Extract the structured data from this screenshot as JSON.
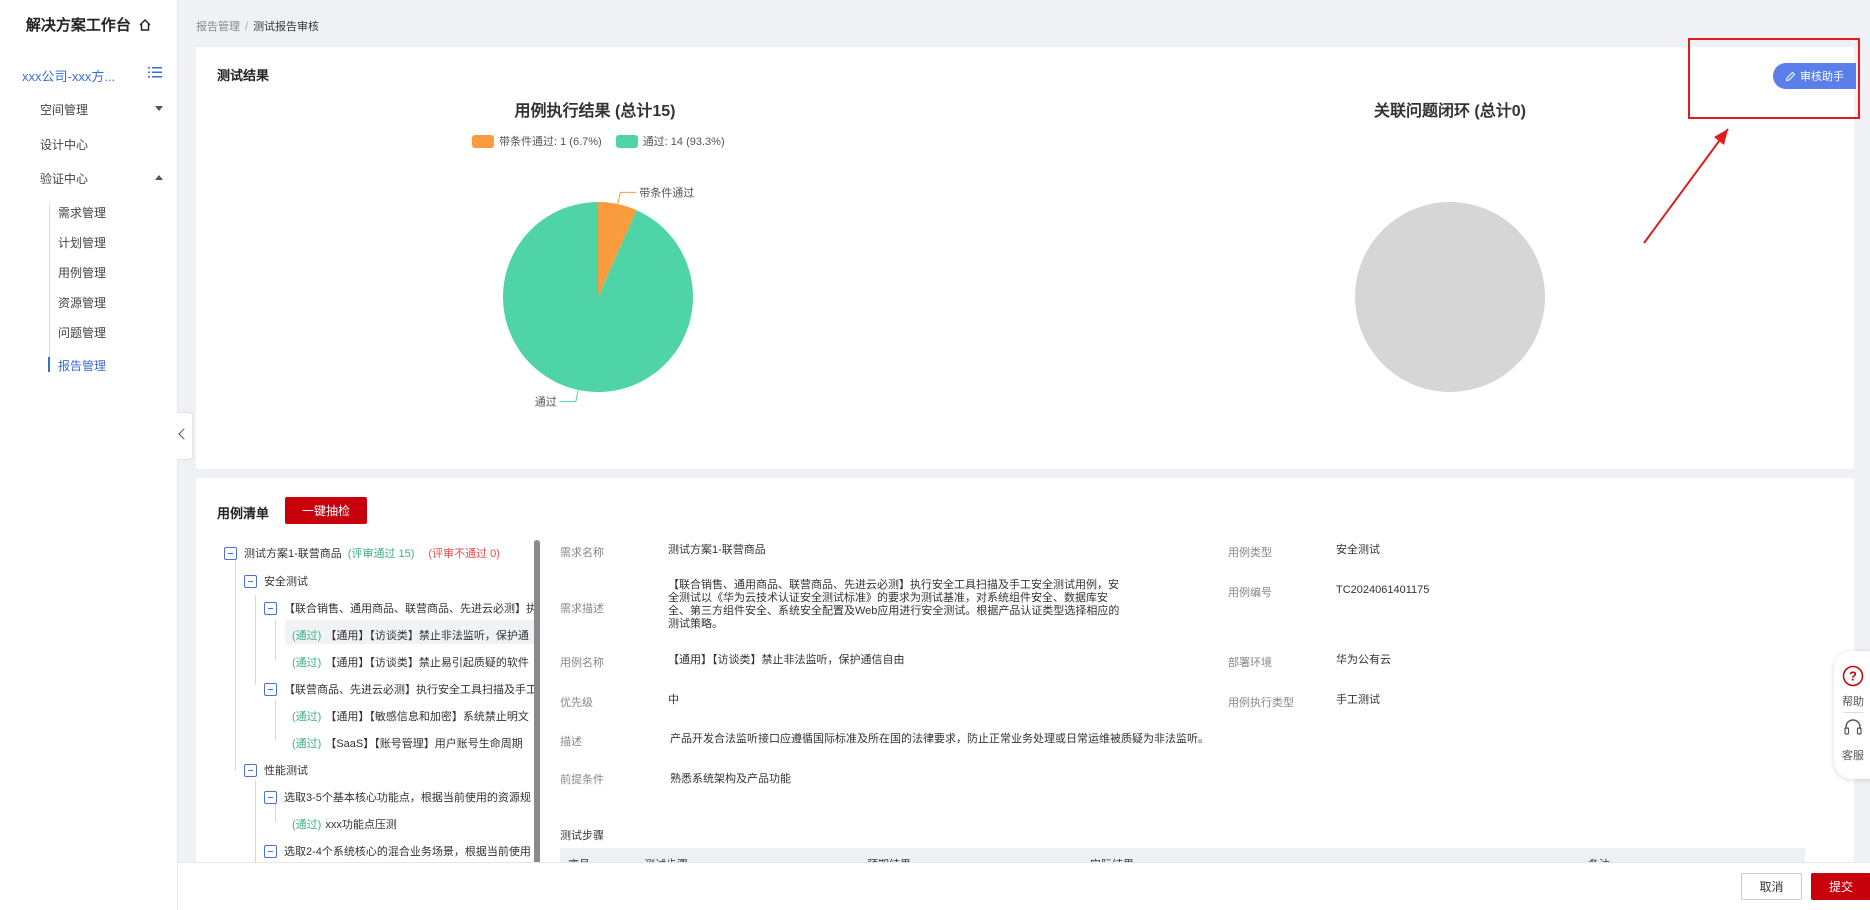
{
  "sidebar": {
    "title": "解决方案工作台",
    "project": "xxx公司-xxx方...",
    "items": [
      {
        "label": "空间管理"
      },
      {
        "label": "设计中心"
      },
      {
        "label": "验证中心"
      }
    ],
    "sub_items": [
      {
        "label": "需求管理"
      },
      {
        "label": "计划管理"
      },
      {
        "label": "用例管理"
      },
      {
        "label": "资源管理"
      },
      {
        "label": "问题管理"
      },
      {
        "label": "报告管理"
      }
    ],
    "active_sub": "报告管理"
  },
  "breadcrumb": {
    "parent": "报告管理",
    "separator": "/",
    "current": "测试报告审核"
  },
  "results": {
    "header": "测试结果",
    "review_assistant_label": "审核助手"
  },
  "chart_data": [
    {
      "type": "pie",
      "title": "用例执行结果 (总计15)",
      "legend": [
        "带条件通过: 1 (6.7%)",
        "通过: 14 (93.3%)"
      ],
      "categories": [
        "带条件通过",
        "通过"
      ],
      "values": [
        1,
        14
      ],
      "colors": [
        "#f89c3e",
        "#4fd4a8"
      ],
      "slice_labels": [
        "带条件通过",
        "通过"
      ]
    },
    {
      "type": "pie",
      "title": "关联问题闭环 (总计0)",
      "categories": [],
      "values": [],
      "colors": [
        "#d6d6d6"
      ]
    }
  ],
  "case_list": {
    "header": "用例清单",
    "quick_button": "一键抽检",
    "tree": [
      {
        "status": "",
        "text": "测试方案1-联营商品",
        "pass": "(评审通过 15)",
        "fail": "(评审不通过 0)"
      },
      {
        "status": "",
        "text": "安全测试"
      },
      {
        "status": "",
        "text": "【联合销售、通用商品、联营商品、先进云必测】执"
      },
      {
        "status": "(通过)",
        "text": "【通用】【访谈类】禁止非法监听，保护通"
      },
      {
        "status": "(通过)",
        "text": "【通用】【访谈类】禁止易引起质疑的软件"
      },
      {
        "status": "",
        "text": "【联营商品、先进云必测】执行安全工具扫描及手工"
      },
      {
        "status": "(通过)",
        "text": "【通用】【敏感信息和加密】系统禁止明文"
      },
      {
        "status": "(通过)",
        "text": "【SaaS】【账号管理】用户账号生命周期"
      },
      {
        "status": "",
        "text": "性能测试"
      },
      {
        "status": "",
        "text": "选取3-5个基本核心功能点，根据当前使用的资源规"
      },
      {
        "status": "(通过)",
        "text": "xxx功能点压测"
      },
      {
        "status": "",
        "text": "选取2-4个系统核心的混合业务场景，根据当前使用"
      }
    ]
  },
  "detail": {
    "req_name_label": "需求名称",
    "req_name": "测试方案1-联营商品",
    "case_type_label": "用例类型",
    "case_type": "安全测试",
    "req_desc_label": "需求描述",
    "req_desc_1": "【联合销售、通用商品、联营商品、先进云必测】执行安全工具扫描及手工安全测试用例，安",
    "req_desc_2": "全测试以《华为云技术认证安全测试标准》的要求为测试基准，对系统组件安全、数据库安",
    "req_desc_3": "全、第三方组件安全、系统安全配置及Web应用进行安全测试。根据产品认证类型选择相应的",
    "req_desc_4": "测试策略。",
    "case_no_label": "用例编号",
    "case_no": "TC2024061401175",
    "case_name_label": "用例名称",
    "case_name": "【通用】【访谈类】禁止非法监听，保护通信自由",
    "deploy_env_label": "部署环境",
    "deploy_env": "华为公有云",
    "priority_label": "优先级",
    "priority": "中",
    "exec_type_label": "用例执行类型",
    "exec_type": "手工测试",
    "desc_label": "描述",
    "desc": "产品开发合法监听接口应遵循国际标准及所在国的法律要求，防止正常业务处理或日常运维被质疑为非法监听。",
    "precond_label": "前提条件",
    "precond": "熟悉系统架构及产品功能",
    "steps_title": "测试步骤",
    "steps_columns": [
      "序号",
      "测试步骤",
      "预期结果",
      "实际结果",
      "备注"
    ]
  },
  "footer": {
    "cancel": "取消",
    "submit": "提交"
  },
  "float_help": {
    "help": "帮助",
    "service": "客服"
  }
}
